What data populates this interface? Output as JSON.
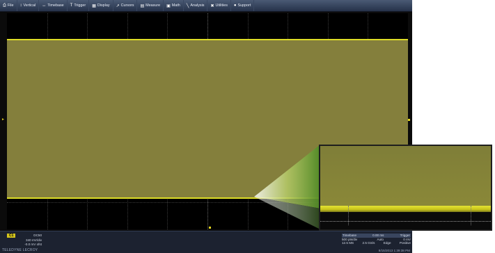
{
  "menu": {
    "items": [
      {
        "label": "File",
        "icon": "file-icon",
        "glyph": "⎙"
      },
      {
        "label": "Vertical",
        "icon": "vertical-icon",
        "glyph": "↕"
      },
      {
        "label": "Timebase",
        "icon": "timebase-icon",
        "glyph": "↔"
      },
      {
        "label": "Trigger",
        "icon": "trigger-icon",
        "glyph": "T"
      },
      {
        "label": "Display",
        "icon": "display-icon",
        "glyph": "▦"
      },
      {
        "label": "Cursors",
        "icon": "cursors-icon",
        "glyph": "↗"
      },
      {
        "label": "Measure",
        "icon": "measure-icon",
        "glyph": "▤"
      },
      {
        "label": "Math",
        "icon": "math-icon",
        "glyph": "▣"
      },
      {
        "label": "Analysis",
        "icon": "analysis-icon",
        "glyph": "╲"
      },
      {
        "label": "Utilities",
        "icon": "utilities-icon",
        "glyph": "✖"
      },
      {
        "label": "Support",
        "icon": "support-icon",
        "glyph": "●"
      }
    ]
  },
  "colors": {
    "trace": "#dedd27",
    "trace_fill": "#847f3c",
    "channel1": "#d4c41d",
    "menubar": "#26324a"
  },
  "channel1": {
    "badge": "C1",
    "coupling": "DC50",
    "volts_per_div": "340 mV/div",
    "offset": "-0.0 mV ofst"
  },
  "timebase": {
    "label": "Timebase",
    "delay": "0.00 ms",
    "trigger_label": "Trigger",
    "samples": "500 pts/div",
    "mode": "Auto",
    "level": "0 mV",
    "sample_rate_row": "12.5 MS",
    "rate": "2.5 GS/s",
    "type": "Edge",
    "slope": "Positive"
  },
  "status": {
    "brand": "TELEDYNE LECROY",
    "timestamp": "8/15/2013 1:39:38 PM"
  }
}
